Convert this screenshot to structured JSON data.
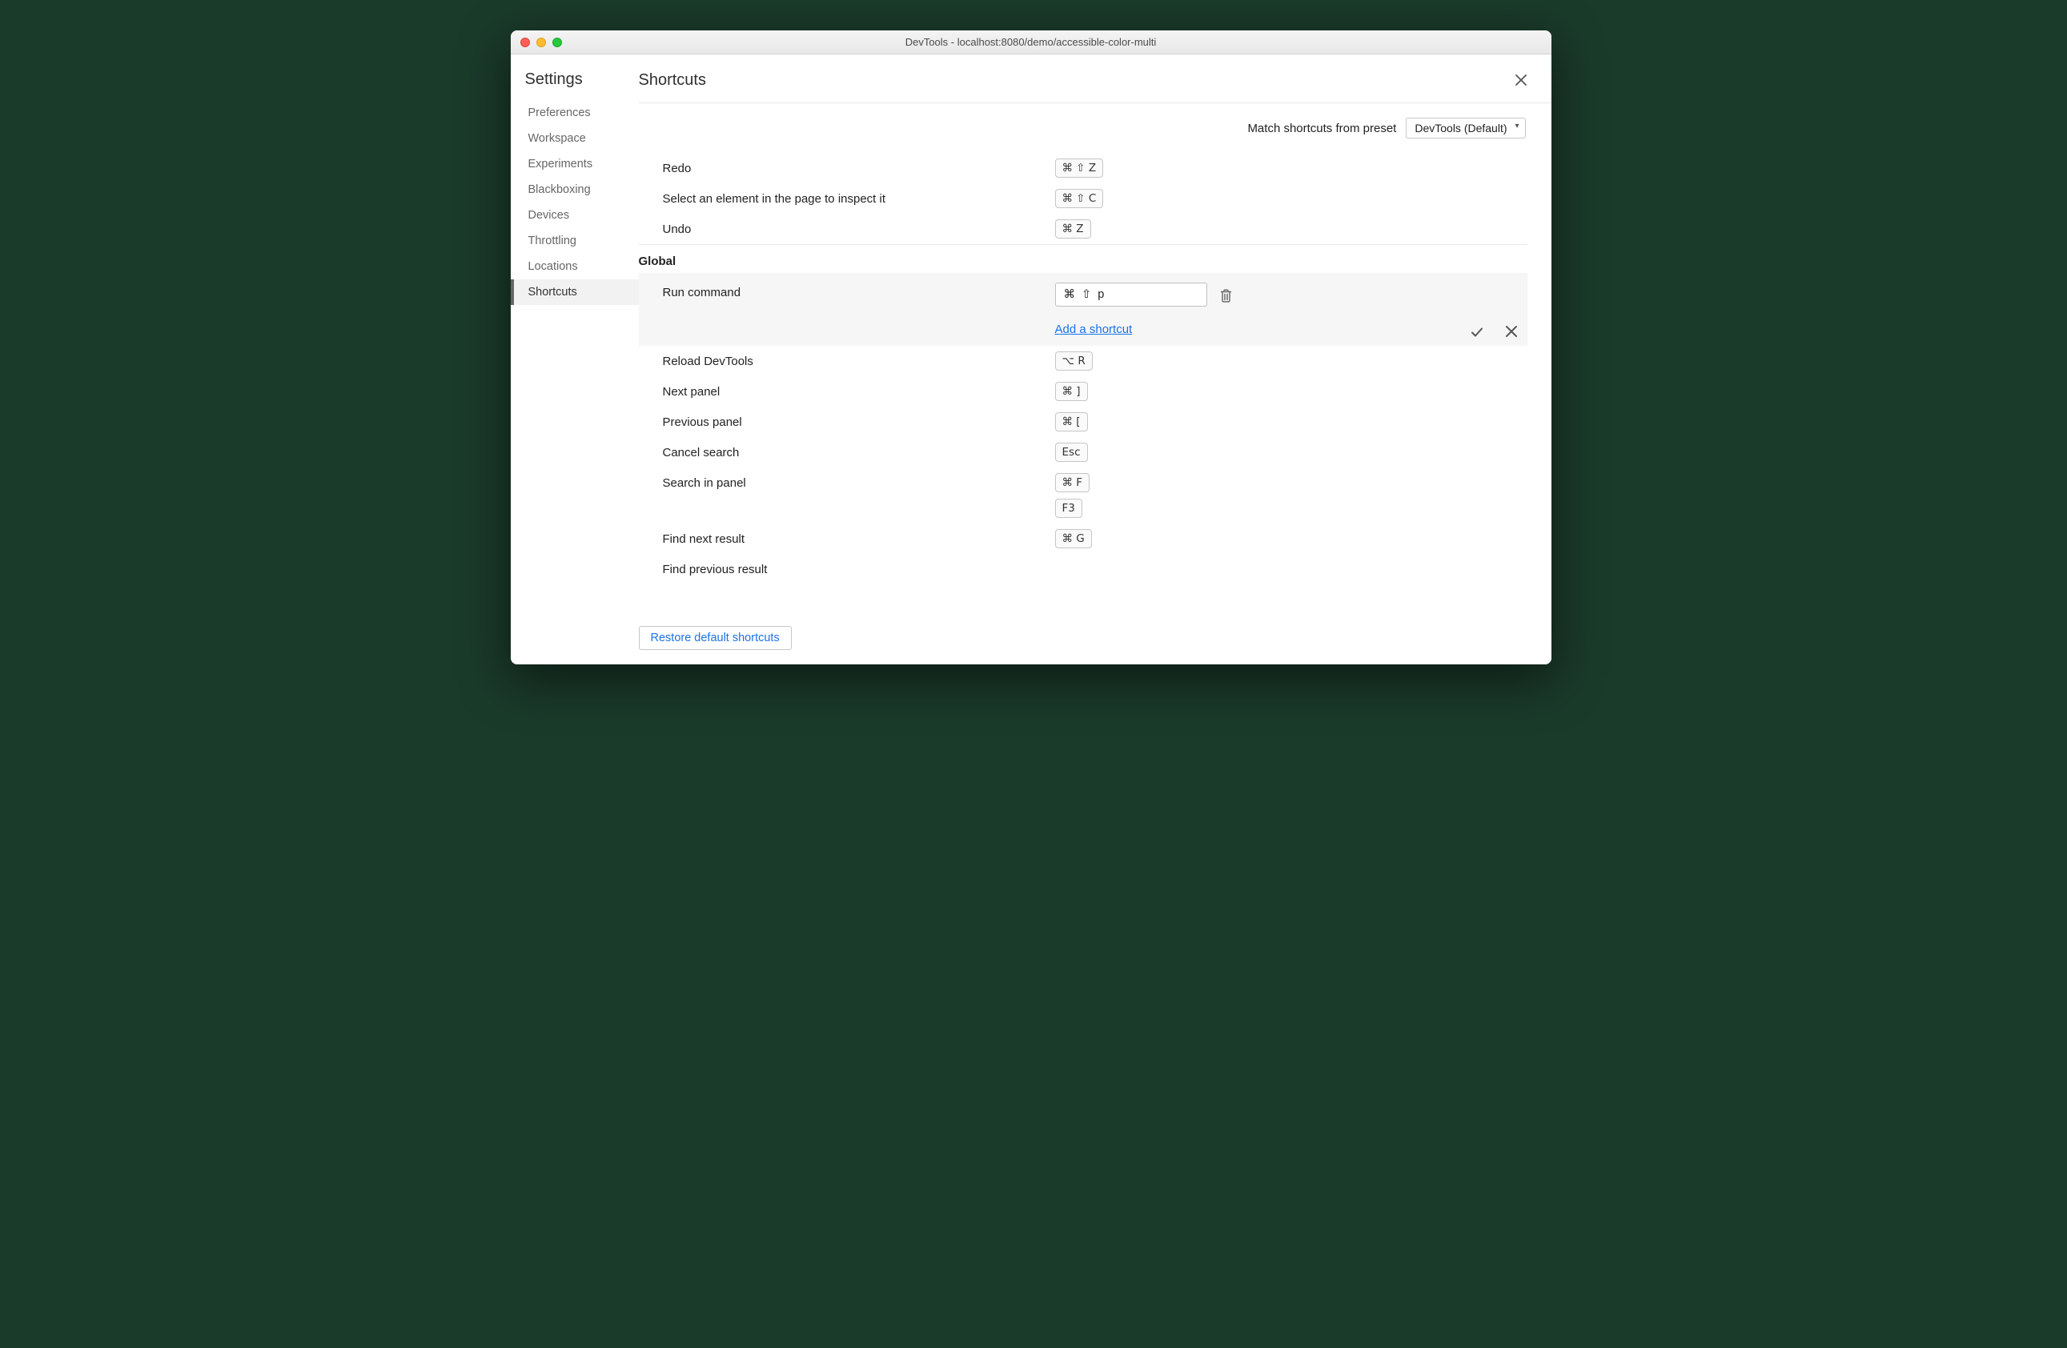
{
  "window": {
    "title": "DevTools - localhost:8080/demo/accessible-color-multi"
  },
  "sidebar": {
    "title": "Settings",
    "items": [
      {
        "label": "Preferences"
      },
      {
        "label": "Workspace"
      },
      {
        "label": "Experiments"
      },
      {
        "label": "Blackboxing"
      },
      {
        "label": "Devices"
      },
      {
        "label": "Throttling"
      },
      {
        "label": "Locations"
      },
      {
        "label": "Shortcuts"
      }
    ],
    "active_index": 7
  },
  "main": {
    "title": "Shortcuts",
    "preset_label": "Match shortcuts from preset",
    "preset_value": "DevTools (Default)",
    "restore_label": "Restore default shortcuts",
    "add_shortcut_label": "Add a shortcut"
  },
  "top_rows": [
    {
      "label": "Redo",
      "shortcuts": [
        "⌘ ⇧ Z"
      ]
    },
    {
      "label": "Select an element in the page to inspect it",
      "shortcuts": [
        "⌘ ⇧ C"
      ]
    },
    {
      "label": "Undo",
      "shortcuts": [
        "⌘ Z"
      ]
    }
  ],
  "global_section": {
    "title": "Global",
    "edit_row": {
      "label": "Run command",
      "input_value": "⌘  ⇧  p"
    },
    "rows": [
      {
        "label": "Reload DevTools",
        "shortcuts": [
          "⌥ R"
        ]
      },
      {
        "label": "Next panel",
        "shortcuts": [
          "⌘ ]"
        ]
      },
      {
        "label": "Previous panel",
        "shortcuts": [
          "⌘ ["
        ]
      },
      {
        "label": "Cancel search",
        "shortcuts": [
          "Esc"
        ]
      },
      {
        "label": "Search in panel",
        "shortcuts": [
          "⌘ F",
          "F3"
        ]
      },
      {
        "label": "Find next result",
        "shortcuts": [
          "⌘ G"
        ]
      },
      {
        "label": "Find previous result",
        "shortcuts": []
      }
    ]
  }
}
